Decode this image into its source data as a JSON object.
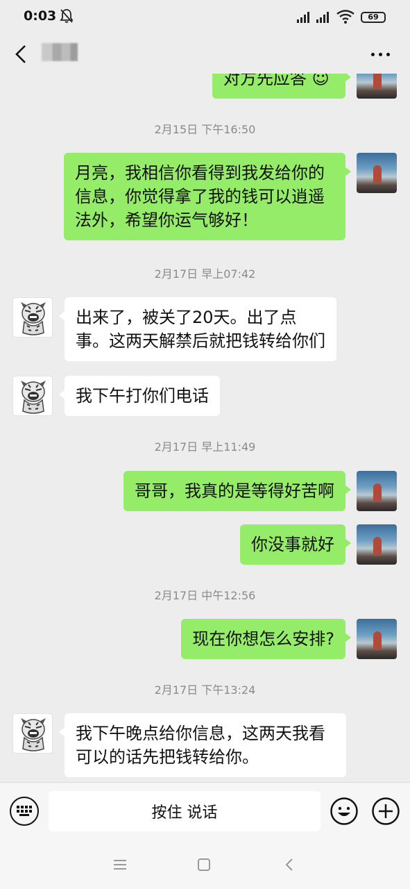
{
  "status_bar": {
    "time": "0:03",
    "battery": "69"
  },
  "header": {
    "contact_name": "••"
  },
  "messages": [
    {
      "id": "m0",
      "side": "me",
      "text": "对方先应答 ☺"
    },
    {
      "id": "ts1",
      "type": "time",
      "text": "2月15日 下午16:50"
    },
    {
      "id": "m1",
      "side": "me",
      "text": "月亮，我相信你看得到我发给你的信息，你觉得拿了我的钱可以逍遥法外，希望你运气够好！"
    },
    {
      "id": "ts2",
      "type": "time",
      "text": "2月17日 早上07:42"
    },
    {
      "id": "m2",
      "side": "them",
      "text": "出来了，被关了20天。出了点事。这两天解禁后就把钱转给你们"
    },
    {
      "id": "m3",
      "side": "them",
      "text": "我下午打你们电话"
    },
    {
      "id": "ts3",
      "type": "time",
      "text": "2月17日 早上11:49"
    },
    {
      "id": "m4",
      "side": "me",
      "text": "哥哥，我真的是等得好苦啊"
    },
    {
      "id": "m5",
      "side": "me",
      "text": "你没事就好"
    },
    {
      "id": "ts4",
      "type": "time",
      "text": "2月17日 中午12:56"
    },
    {
      "id": "m6",
      "side": "me",
      "text": "现在你想怎么安排?"
    },
    {
      "id": "ts5",
      "type": "time",
      "text": "2月17日 下午13:24"
    },
    {
      "id": "m7",
      "side": "them",
      "text": "我下午晚点给你信息，这两天我看可以的话先把钱转给你。"
    }
  ],
  "input_bar": {
    "hold_to_talk": "按住 说话"
  },
  "colors": {
    "my_bubble": "#95ec69",
    "their_bubble": "#ffffff",
    "background": "#ededed"
  },
  "icons": [
    "mute-bell-icon",
    "signal-icon",
    "wifi-icon",
    "back-icon",
    "more-icon",
    "keyboard-icon",
    "emoji-icon",
    "plus-icon",
    "menu-icon",
    "home-icon",
    "nav-back-icon"
  ]
}
